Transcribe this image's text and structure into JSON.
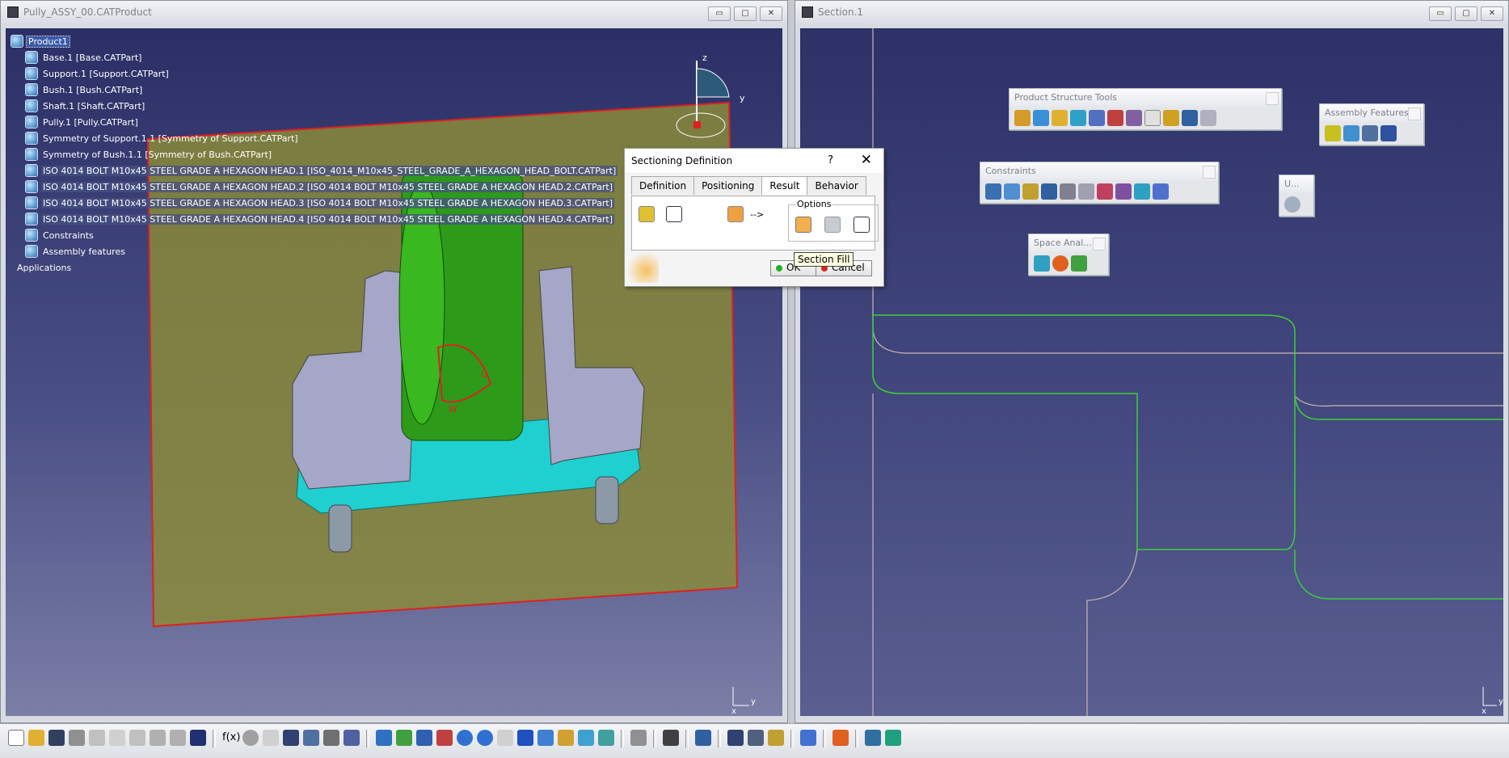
{
  "windows": {
    "left_title": "Pully_ASSY_00.CATProduct",
    "right_title": "Section.1",
    "min": "▭",
    "max": "▢",
    "close": "✕"
  },
  "tree": {
    "root": "Product1",
    "items": [
      {
        "label": "Base.1 [Base.CATPart]"
      },
      {
        "label": "Support.1 [Support.CATPart]"
      },
      {
        "label": "Bush.1 [Bush.CATPart]"
      },
      {
        "label": "Shaft.1 [Shaft.CATPart]"
      },
      {
        "label": "Pully.1 [Pully.CATPart]"
      },
      {
        "label": "Symmetry of Support.1.1 [Symmetry of Support.CATPart]"
      },
      {
        "label": "Symmetry of Bush.1.1 [Symmetry of Bush.CATPart]"
      },
      {
        "label": "ISO 4014 BOLT M10x45 STEEL GRADE A HEXAGON HEAD.1 [ISO_4014_M10x45_STEEL_GRADE_A_HEXAGON_HEAD_BOLT.CATPart]"
      },
      {
        "label": "ISO 4014 BOLT M10x45 STEEL GRADE A HEXAGON HEAD.2 [ISO 4014 BOLT M10x45 STEEL GRADE A HEXAGON HEAD.2.CATPart]"
      },
      {
        "label": "ISO 4014 BOLT M10x45 STEEL GRADE A HEXAGON HEAD.3 [ISO 4014 BOLT M10x45 STEEL GRADE A HEXAGON HEAD.3.CATPart]"
      },
      {
        "label": "ISO 4014 BOLT M10x45 STEEL GRADE A HEXAGON HEAD.4 [ISO 4014 BOLT M10x45 STEEL GRADE A HEXAGON HEAD.4.CATPart]"
      },
      {
        "label": "Constraints"
      },
      {
        "label": "Assembly features"
      },
      {
        "label": "Applications"
      }
    ]
  },
  "compass": {
    "z": "z",
    "y": "y"
  },
  "axes": {
    "x": "x",
    "y": "y"
  },
  "model_labels": {
    "u": "U",
    "w": "W"
  },
  "dialog": {
    "title": "Sectioning Definition",
    "help": "?",
    "close": "✕",
    "tabs": [
      "Definition",
      "Positioning",
      "Result",
      "Behavior"
    ],
    "arrow": "-->",
    "options_label": "Options",
    "tooltip": "Section Fill",
    "ok": "OK",
    "cancel": "Cancel"
  },
  "toolbars": {
    "product_structure": "Product Structure Tools",
    "assembly_features": "Assembly Features",
    "constraints": "Constraints",
    "space_analysis": "Space Anal...",
    "u": "U..."
  },
  "bottom": {
    "fx": "f(x)"
  },
  "colors": {
    "background_top": "#2b2f66",
    "plane": "#8a8a3a",
    "section_line": "#3ccf3c",
    "accent_red": "#e02020"
  }
}
